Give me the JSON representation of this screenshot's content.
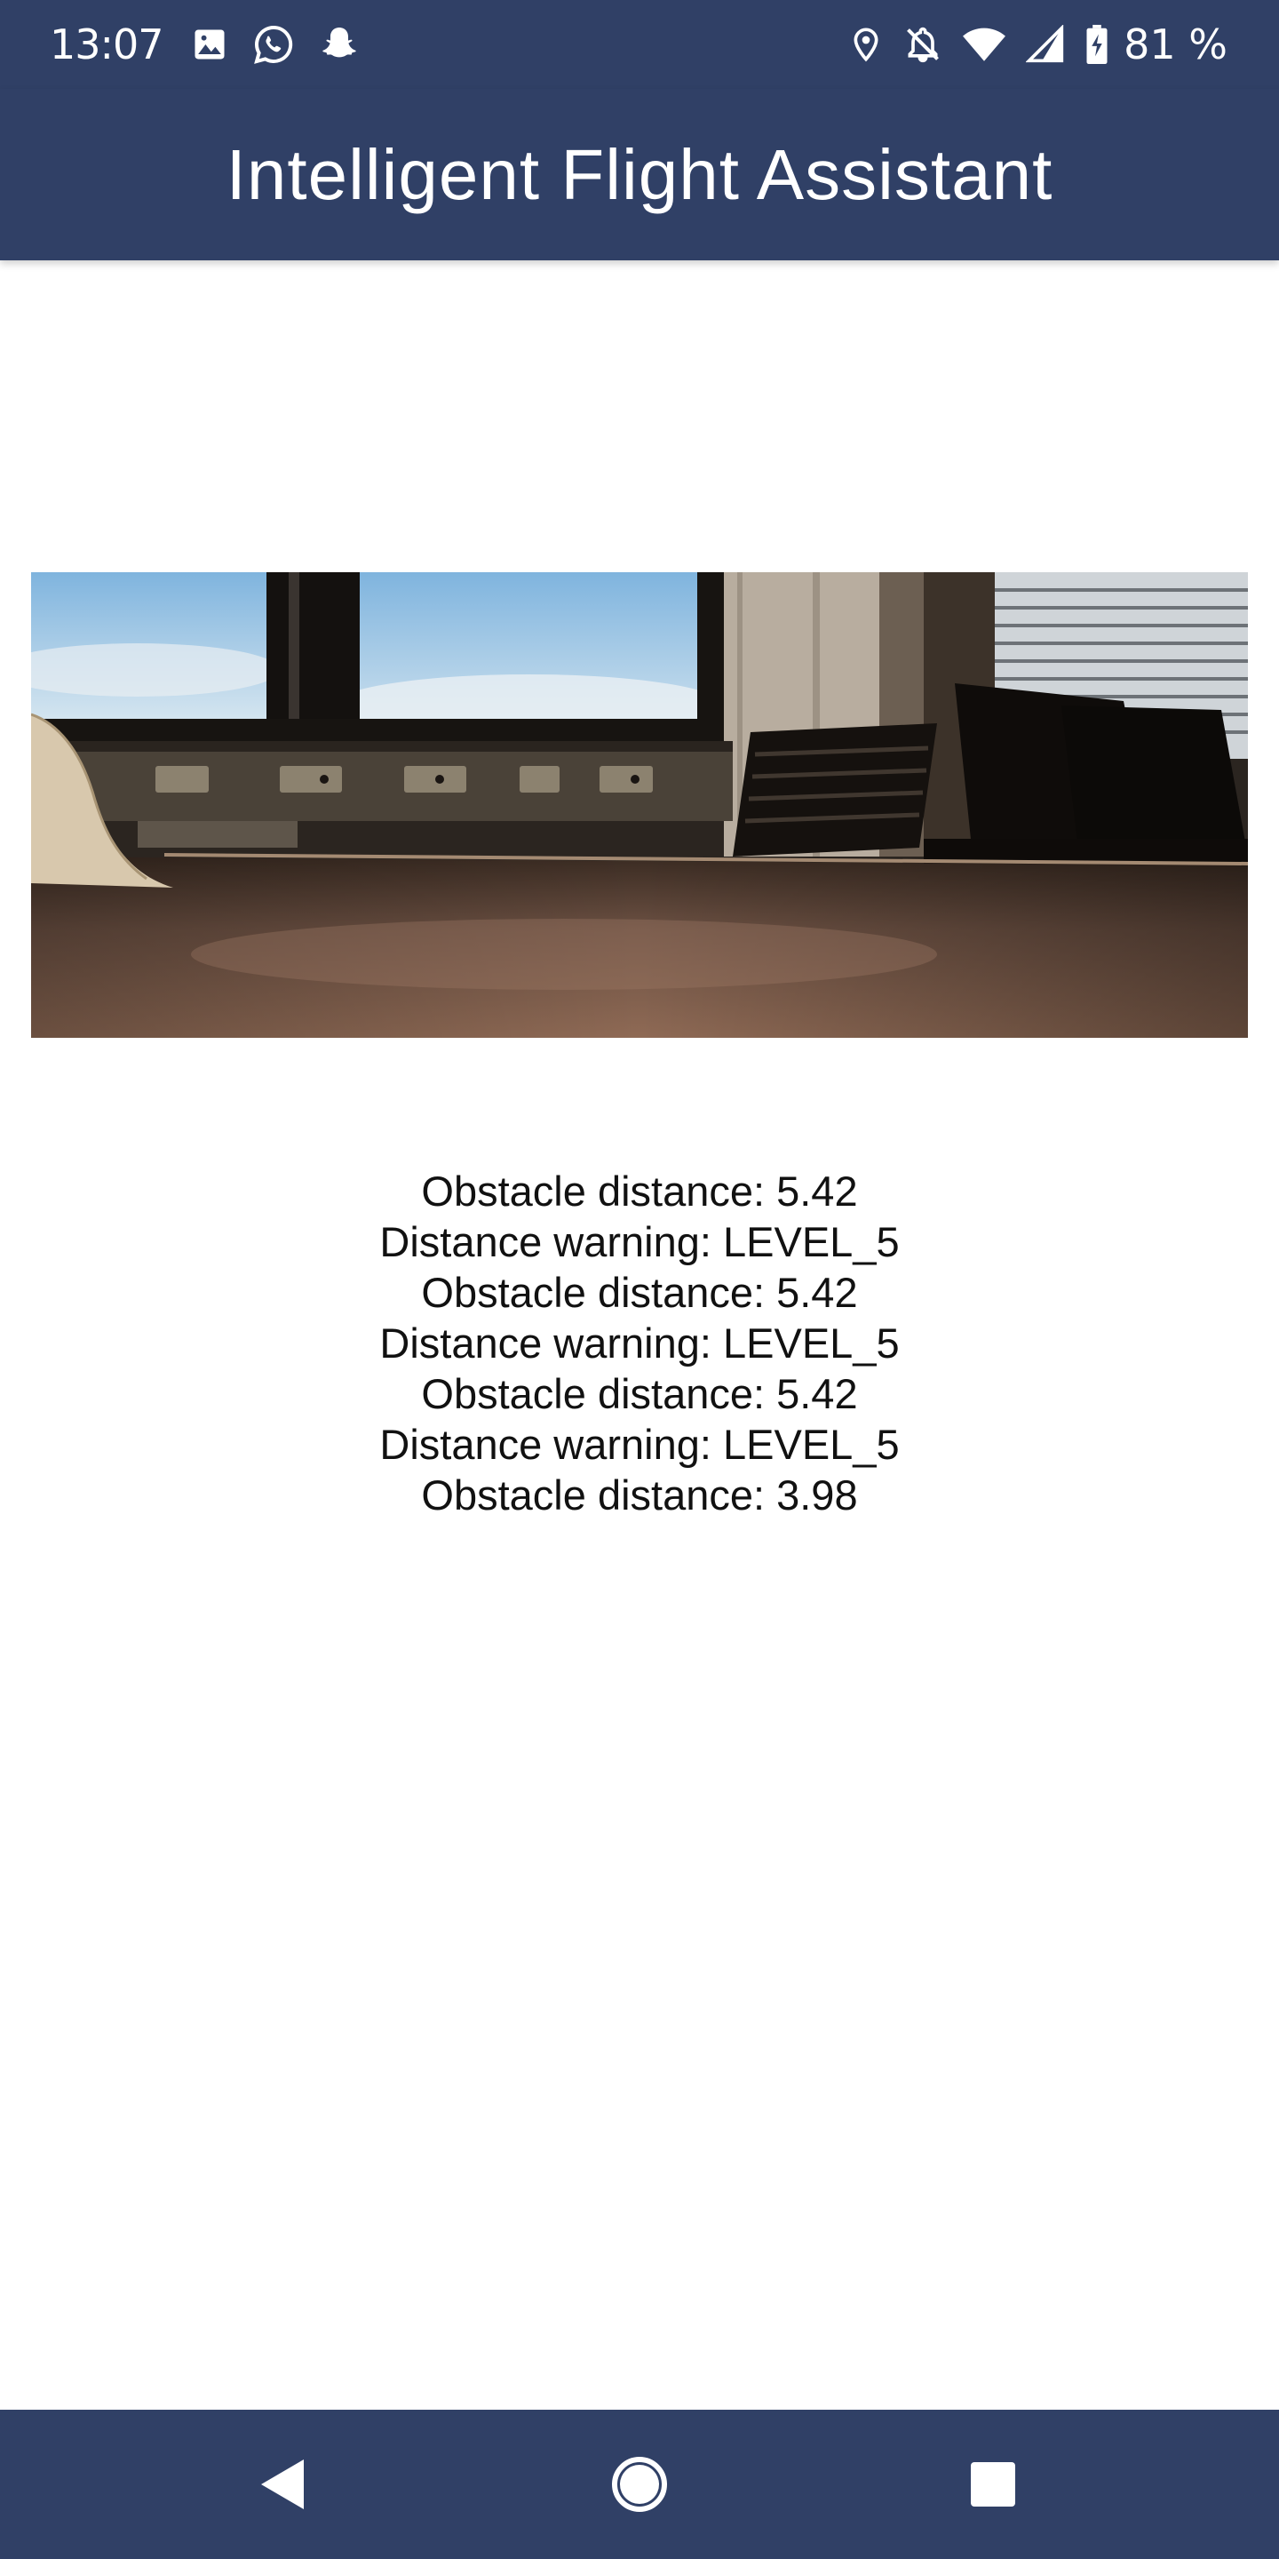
{
  "status_bar": {
    "time": "13:07",
    "battery_percent": "81 %",
    "left_icons": [
      "image-icon",
      "whatsapp-icon",
      "snapchat-icon"
    ],
    "right_icons": [
      "location-icon",
      "notifications-off-icon",
      "wifi-icon",
      "cell-signal-icon",
      "battery-charging-icon"
    ]
  },
  "app_bar": {
    "title": "Intelligent Flight Assistant"
  },
  "camera_feed": {
    "description_icon": "camera-feed-image"
  },
  "log": {
    "lines": [
      "Obstacle distance: 5.42",
      "Distance warning: LEVEL_5",
      "Obstacle distance: 5.42",
      "Distance warning: LEVEL_5",
      "Obstacle distance: 5.42",
      "Distance warning: LEVEL_5",
      "Obstacle distance: 3.98"
    ]
  },
  "nav_bar": {
    "buttons": [
      "back-icon",
      "home-icon",
      "recents-icon"
    ]
  },
  "colors": {
    "primary": "#304066",
    "background": "#ffffff",
    "text": "#111111"
  }
}
